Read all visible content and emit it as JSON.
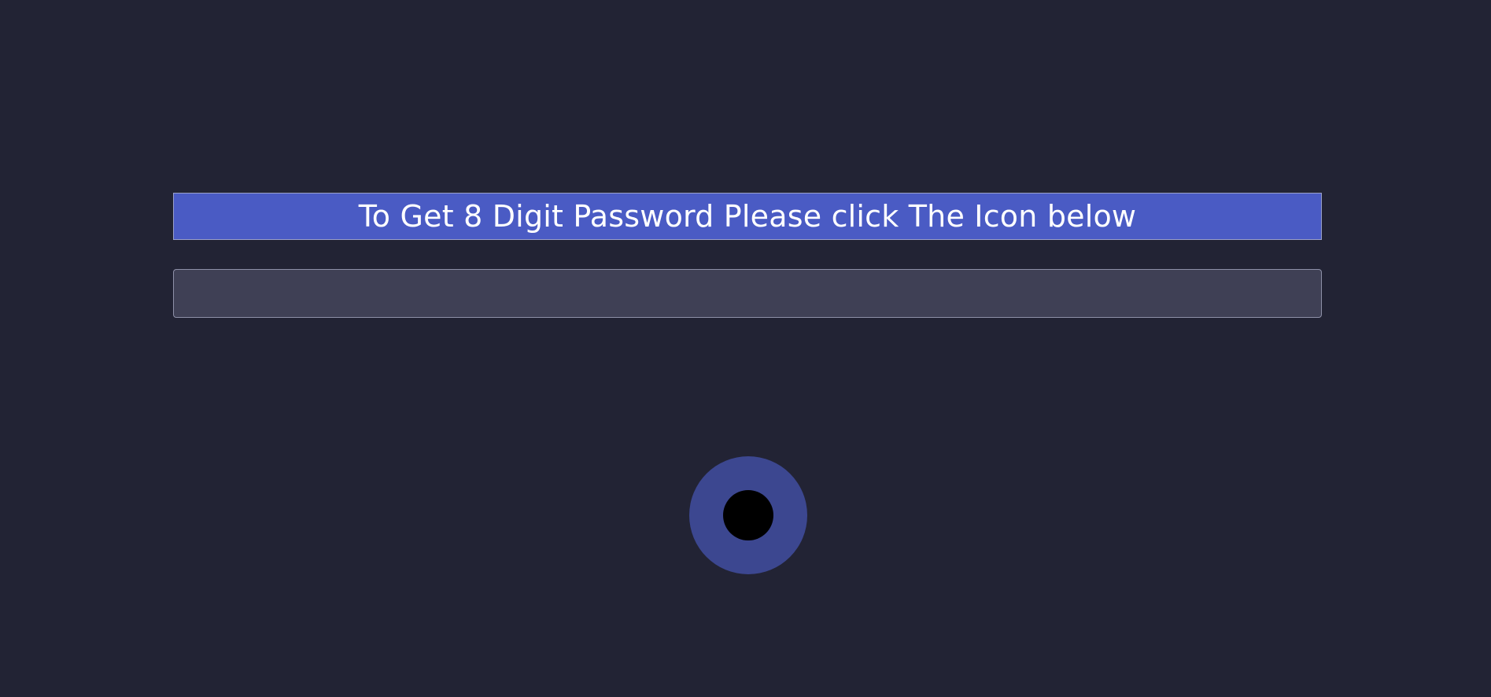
{
  "banner": {
    "text": "To Get 8 Digit Password Please click The Icon below"
  },
  "password_output": {
    "value": "",
    "placeholder": ""
  },
  "generate_button": {
    "icon": "circle-dot-icon"
  },
  "colors": {
    "background": "#222334",
    "banner": "#4a5bc4",
    "input_background": "#3f4055",
    "button_outer": "#3c4790",
    "button_inner": "#000000"
  }
}
